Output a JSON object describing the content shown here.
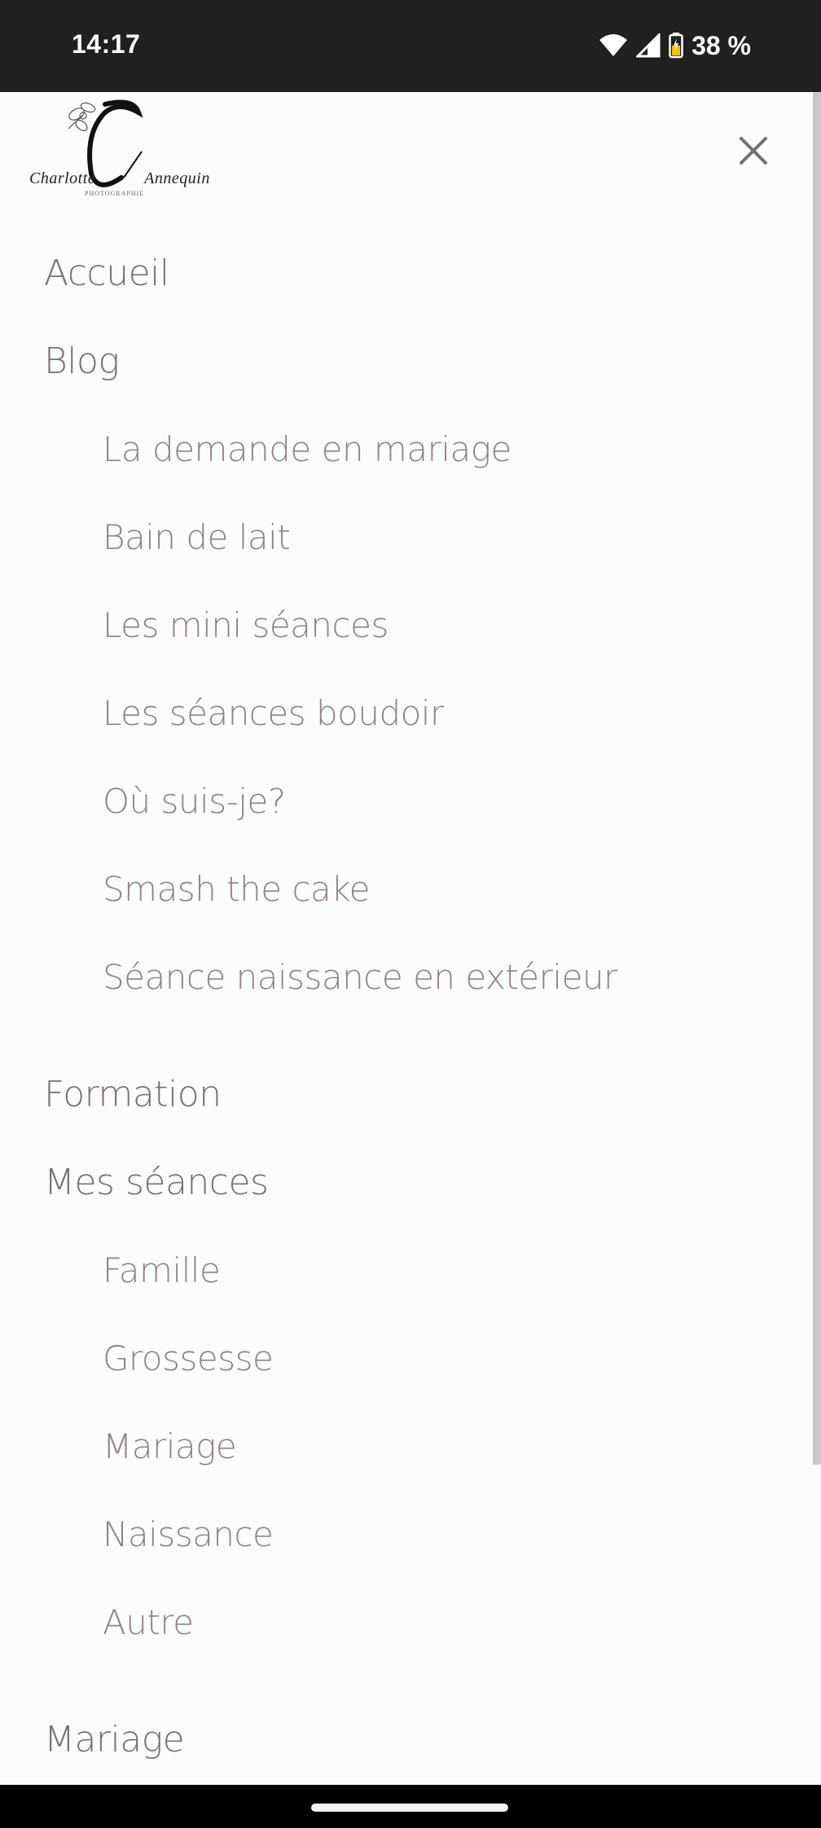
{
  "status_bar": {
    "time": "14:17",
    "battery": "38 %",
    "icons": [
      "wifi-icon",
      "signal-icon",
      "battery-charging-icon"
    ]
  },
  "header": {
    "logo": {
      "name_left": "Charlotte",
      "name_right": "Annequin",
      "tagline": "PHOTOGRAPHIE"
    },
    "close_icon": "close-icon"
  },
  "menu": {
    "items": [
      {
        "label": "Accueil",
        "level": 0
      },
      {
        "label": "Blog",
        "level": 0
      },
      {
        "label": "La demande en mariage",
        "level": 1
      },
      {
        "label": "Bain de lait",
        "level": 1
      },
      {
        "label": "Les mini séances",
        "level": 1
      },
      {
        "label": "Les séances boudoir",
        "level": 1
      },
      {
        "label": "Où suis-je?",
        "level": 1
      },
      {
        "label": "Smash the cake",
        "level": 1
      },
      {
        "label": "Séance naissance en extérieur",
        "level": 1
      },
      {
        "label": "Formation",
        "level": 0
      },
      {
        "label": "Mes séances",
        "level": 0
      },
      {
        "label": "Famille",
        "level": 1
      },
      {
        "label": "Grossesse",
        "level": 1
      },
      {
        "label": "Mariage",
        "level": 1
      },
      {
        "label": "Naissance",
        "level": 1
      },
      {
        "label": "Autre",
        "level": 1
      },
      {
        "label": "Mariage",
        "level": 0
      }
    ]
  },
  "colors": {
    "menu_text": "#7a6e76",
    "background": "#fdfcfd",
    "status_bar": "#202020"
  }
}
